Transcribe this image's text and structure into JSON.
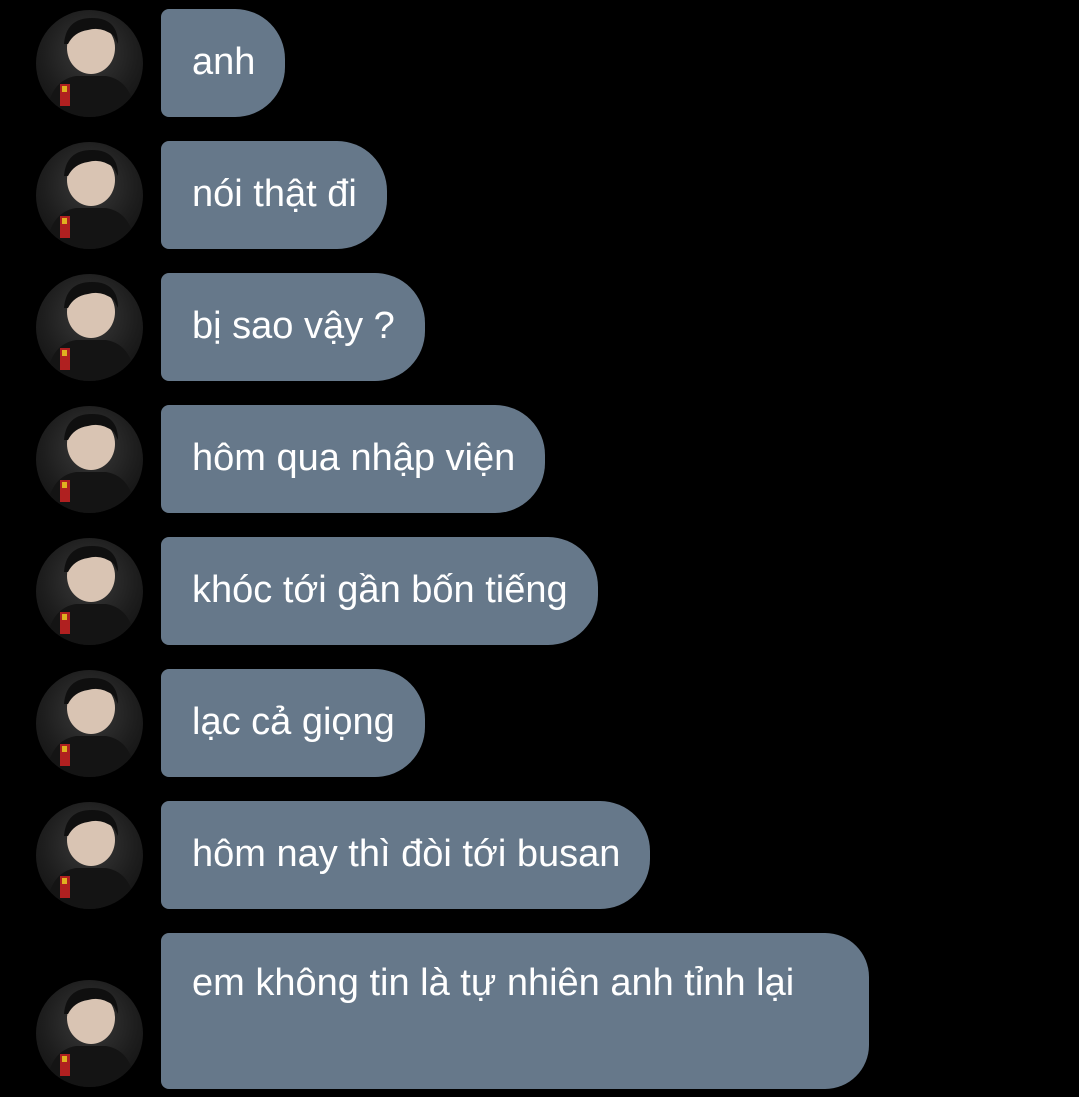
{
  "colors": {
    "background": "#000000",
    "bubble": "#66788a",
    "text": "#ffffff"
  },
  "avatar_icon": "profile-photo",
  "messages": [
    {
      "text": "anh"
    },
    {
      "text": "nói thật đi"
    },
    {
      "text": "bị sao vậy ?"
    },
    {
      "text": "hôm qua nhập viện"
    },
    {
      "text": "khóc tới gần bốn tiếng"
    },
    {
      "text": "lạc cả giọng"
    },
    {
      "text": "hôm nay thì đòi tới busan"
    },
    {
      "text": "em không tin là tự nhiên anh tỉnh lại"
    }
  ]
}
